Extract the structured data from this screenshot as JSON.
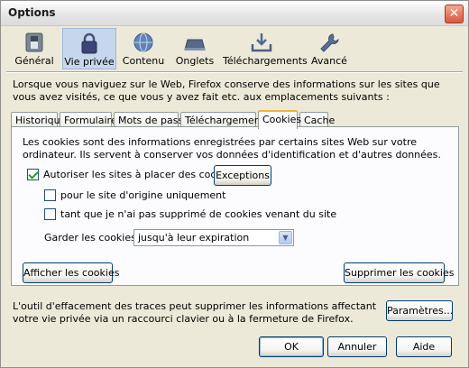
{
  "window": {
    "title": "Options",
    "close_glyph": "✕"
  },
  "toolbar": {
    "items": [
      {
        "label": "Général",
        "icon": "switch-icon"
      },
      {
        "label": "Vie privée",
        "icon": "padlock-icon"
      },
      {
        "label": "Contenu",
        "icon": "globe-icon"
      },
      {
        "label": "Onglets",
        "icon": "tabs-icon"
      },
      {
        "label": "Téléchargements",
        "icon": "download-icon"
      },
      {
        "label": "Avancé",
        "icon": "wrench-icon"
      }
    ],
    "selected": "Vie privée"
  },
  "intro": "Lorsque vous naviguez sur le Web, Firefox conserve des informations sur les sites que vous avez visités, ce que vous y avez fait etc. aux emplacements suivants :",
  "tabs": [
    "Historique",
    "Formulaires",
    "Mots de passe",
    "Téléchargements",
    "Cookies",
    "Cache"
  ],
  "active_tab": "Cookies",
  "cookies": {
    "description": "Les cookies sont des informations enregistrées par certains sites Web sur votre ordinateur. Ils servent à conserver vos données d'identification et d'autres données.",
    "allow_label": "Autoriser les sites à placer des cookies",
    "allow_checked": true,
    "exceptions_button": "Exceptions",
    "origin_only_label": "pour le site d'origine uniquement",
    "origin_only_checked": false,
    "until_deleted_label": "tant que je n'ai pas supprimé de cookies venant du site",
    "until_deleted_checked": false,
    "keep_label": "Garder les cookies :",
    "keep_value": "jusqu'à leur expiration",
    "show_button": "Afficher les cookies",
    "delete_button": "Supprimer les cookies"
  },
  "clear_text": "L'outil d'effacement des traces peut supprimer les informations affectant votre vie privée via un raccourci clavier ou à la fermeture de Firefox.",
  "settings_button": "Paramètres...",
  "ok_button": "OK",
  "cancel_button": "Annuler",
  "help_button": "Aide",
  "colors": {
    "dialog_bg": "#ece9d8",
    "selected_toolbar": "#c6d6ec",
    "active_tab_accent": "#f2b33c",
    "check_green": "#21a121"
  }
}
